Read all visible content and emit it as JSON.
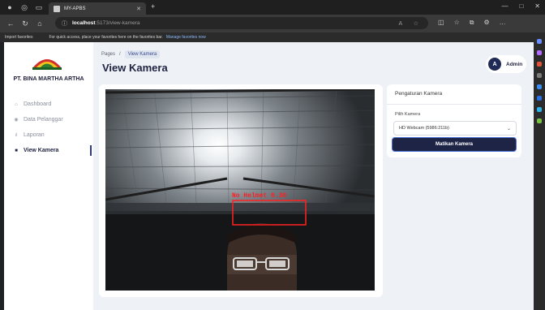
{
  "browser": {
    "tab_title": "MY-APBS",
    "url_host": "localhost",
    "url_path": ":5173/view-kamera",
    "favorites": {
      "import_label": "Import favorites",
      "message": "For quick access, place your favorites here on the favorites bar.",
      "manage_link": "Manage favorites now"
    }
  },
  "sidebar": {
    "brand": "PT. BINA MARTHA ARTHA",
    "items": [
      {
        "label": "Dashboard",
        "icon": "home-icon"
      },
      {
        "label": "Data Pelanggar",
        "icon": "database-icon"
      },
      {
        "label": "Laporan",
        "icon": "chart-icon"
      },
      {
        "label": "View Kamera",
        "icon": "camera-icon",
        "active": true
      }
    ]
  },
  "header": {
    "breadcrumb_root": "Pages",
    "breadcrumb_sep": "/",
    "breadcrumb_current": "View Kamera",
    "title": "View Kamera",
    "user_initial": "A",
    "user_name": "Admin"
  },
  "camera": {
    "detection_label": "No Helmet 0.30",
    "detection_color": "#ff2020"
  },
  "settings": {
    "title": "Pengaturan Kamera",
    "select_label": "Pilih Kamera",
    "selected_camera": "HD Webcam (5986:211b)",
    "stop_button": "Matikan Kamera"
  }
}
